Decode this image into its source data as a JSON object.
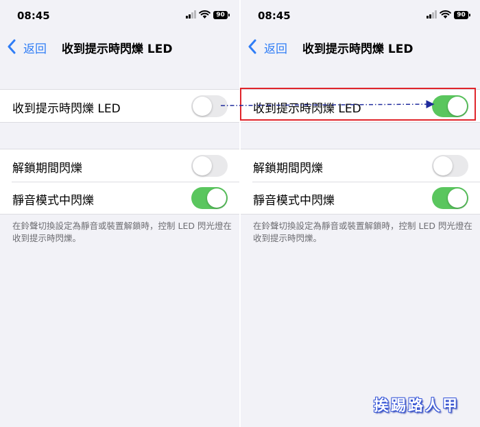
{
  "left": {
    "status": {
      "time": "08:45",
      "battery": "90"
    },
    "nav": {
      "back_label": "返回",
      "title": "收到提示時閃爍 LED"
    },
    "group1": {
      "row": {
        "label": "收到提示時閃爍 LED",
        "toggle_on": false
      }
    },
    "group2": {
      "rows": [
        {
          "label": "解鎖期間閃爍",
          "toggle_on": false
        },
        {
          "label": "靜音模式中閃爍",
          "toggle_on": true
        }
      ]
    },
    "footnote": "在鈴聲切換設定為靜音或裝置解鎖時，控制 LED 閃光燈在收到提示時閃爍。"
  },
  "right": {
    "status": {
      "time": "08:45",
      "battery": "90"
    },
    "nav": {
      "back_label": "返回",
      "title": "收到提示時閃爍 LED"
    },
    "group1": {
      "row": {
        "label": "收到提示時閃爍 LED",
        "toggle_on": true
      }
    },
    "group2": {
      "rows": [
        {
          "label": "解鎖期間閃爍",
          "toggle_on": false
        },
        {
          "label": "靜音模式中閃爍",
          "toggle_on": true
        }
      ]
    },
    "footnote": "在鈴聲切換設定為靜音或裝置解鎖時，控制 LED 閃光燈在收到提示時閃爍。"
  },
  "colors": {
    "accent_blue": "#2f7df6",
    "toggle_on_green": "#5ac65e",
    "toggle_off_gray": "#e9e9eb",
    "highlight_red": "#e0242a",
    "arrow_navy": "#1f2a9c"
  },
  "watermark": "挨踢路人甲"
}
